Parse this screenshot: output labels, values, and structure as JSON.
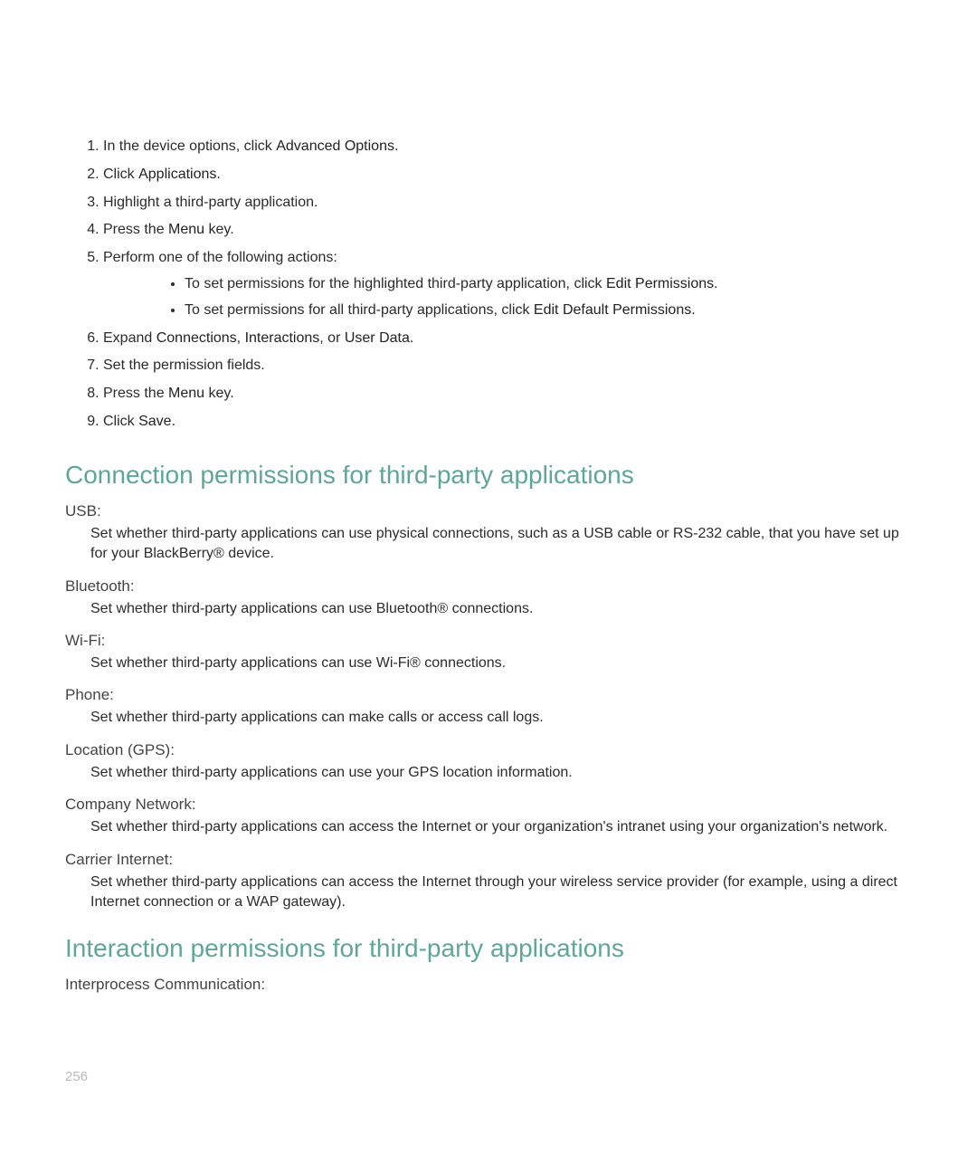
{
  "steps": {
    "1_pre": "In the device options, click ",
    "1_term": "Advanced Options.",
    "2_pre": "Click ",
    "2_term": "Applications.",
    "3": "Highlight a third-party application.",
    "4_pre": "Press the ",
    "4_term": "Menu",
    "4_post": " key.",
    "5": "Perform one of the following actions:",
    "5a_pre": "To set permissions for the highlighted third-party application, click ",
    "5a_term": "Edit Permissions.",
    "5b_pre": "To set permissions for all third-party applications, click ",
    "5b_term": "Edit Default Permissions.",
    "6_pre": "Expand ",
    "6_t1": "Connections",
    "6_mid1": ", ",
    "6_t2": "Interactions",
    "6_mid2": ", or ",
    "6_t3": "User Data.",
    "7": "Set the permission fields.",
    "8_pre": "Press the ",
    "8_term": "Menu",
    "8_post": " key.",
    "9_pre": "Click ",
    "9_term": "Save."
  },
  "section1": {
    "title": "Connection permissions for third-party applications",
    "items": {
      "usb_t": "USB:",
      "usb_d": "Set whether third-party applications can use physical connections, such as a USB cable or RS-232 cable, that you have set up for your BlackBerry® device.",
      "bt_t": "Bluetooth:",
      "bt_d": "Set whether third-party applications can use Bluetooth® connections.",
      "wifi_t": "Wi-Fi:",
      "wifi_d": "Set whether third-party applications can use Wi-Fi® connections.",
      "phone_t": "Phone:",
      "phone_d": "Set whether third-party applications can make calls or access call logs.",
      "gps_t": "Location (GPS):",
      "gps_d": "Set whether third-party applications can use your GPS location information.",
      "comp_t": "Company Network:",
      "comp_d": "Set whether third-party applications can access the Internet or your organization's intranet using your organization's network.",
      "carr_t": "Carrier Internet:",
      "carr_d": "Set whether third-party applications can access the Internet through your wireless service provider (for example, using a direct Internet connection or a WAP gateway)."
    }
  },
  "section2": {
    "title": "Interaction permissions for third-party applications",
    "items": {
      "ipc_t": "Interprocess Communication:"
    }
  },
  "page_number": "256"
}
